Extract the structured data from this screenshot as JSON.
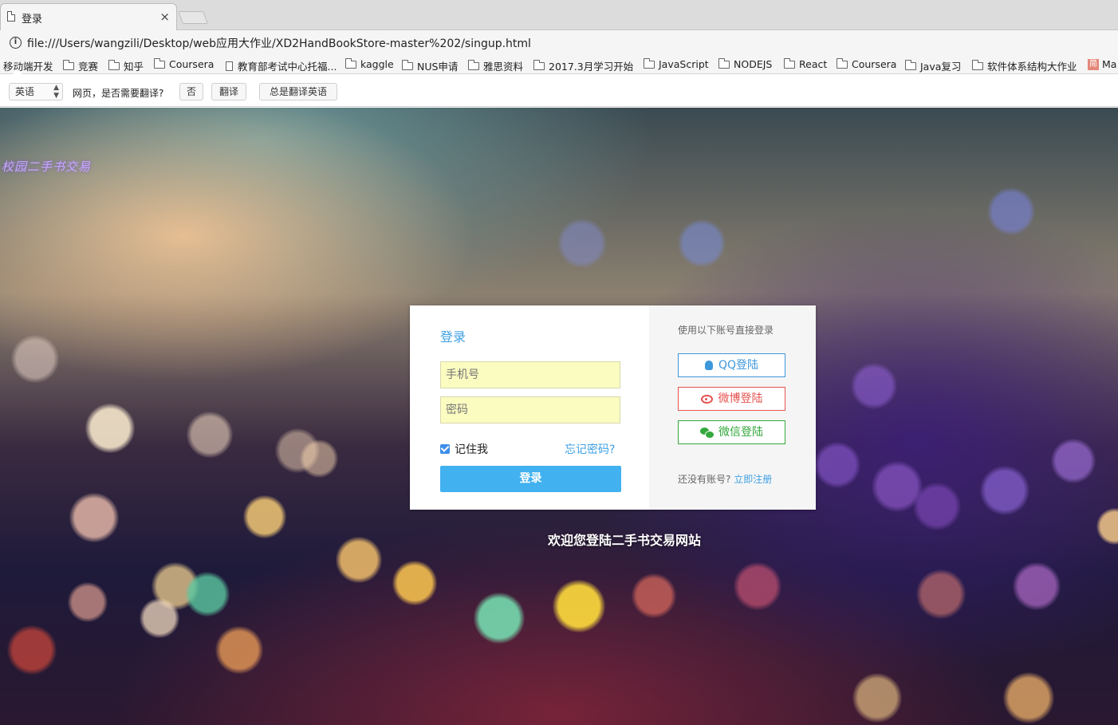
{
  "browser": {
    "tab_title": "登录",
    "tab_close": "×",
    "url": "file:///Users/wangzili/Desktop/web应用大作业/XD2HandBookStore-master%202/singup.html",
    "bookmarks": [
      {
        "label": "移动端开发",
        "icon": "folder-icon"
      },
      {
        "label": "竞赛",
        "icon": "folder-icon"
      },
      {
        "label": "知乎",
        "icon": "folder-icon"
      },
      {
        "label": "Coursera",
        "icon": "folder-icon"
      },
      {
        "label": "教育部考试中心托福...",
        "icon": "page-icon"
      },
      {
        "label": "kaggle",
        "icon": "folder-icon"
      },
      {
        "label": "NUS申请",
        "icon": "folder-icon"
      },
      {
        "label": "雅思资料",
        "icon": "folder-icon"
      },
      {
        "label": "2017.3月学习开始",
        "icon": "folder-icon"
      },
      {
        "label": "JavaScript",
        "icon": "folder-icon"
      },
      {
        "label": "NODEJS",
        "icon": "folder-icon"
      },
      {
        "label": "React",
        "icon": "folder-icon"
      },
      {
        "label": "Coursera",
        "icon": "folder-icon"
      },
      {
        "label": "Java复习",
        "icon": "folder-icon"
      },
      {
        "label": "软件体系结构大作业",
        "icon": "folder-icon"
      },
      {
        "label": "Ma",
        "icon": "simplenote-icon",
        "icon_text": "简"
      }
    ]
  },
  "translate_bar": {
    "language": "英语",
    "prompt": "网页，是否需要翻译?",
    "no_label": "否",
    "translate_label": "翻译",
    "always_label": "总是翻译英语"
  },
  "page": {
    "watermark": "校园二手书交易",
    "login": {
      "title": "登录",
      "phone_placeholder": "手机号",
      "password_placeholder": "密码",
      "remember_label": "记住我",
      "remember_checked": true,
      "forgot_label": "忘记密码?",
      "submit_label": "登录"
    },
    "social": {
      "hint": "使用以下账号直接登录",
      "qq_label": "QQ登陆",
      "weibo_label": "微博登陆",
      "wechat_label": "微信登陆",
      "no_account_text": "还没有账号?",
      "register_link": "立即注册"
    },
    "welcome": "欢迎您登陆二手书交易网站"
  },
  "colors": {
    "accent": "#41b1f0",
    "link": "#3fa0e3",
    "qq": "#3d97db",
    "weibo": "#e6524f",
    "wechat": "#33a83c",
    "input_bg": "#fafcc0"
  }
}
